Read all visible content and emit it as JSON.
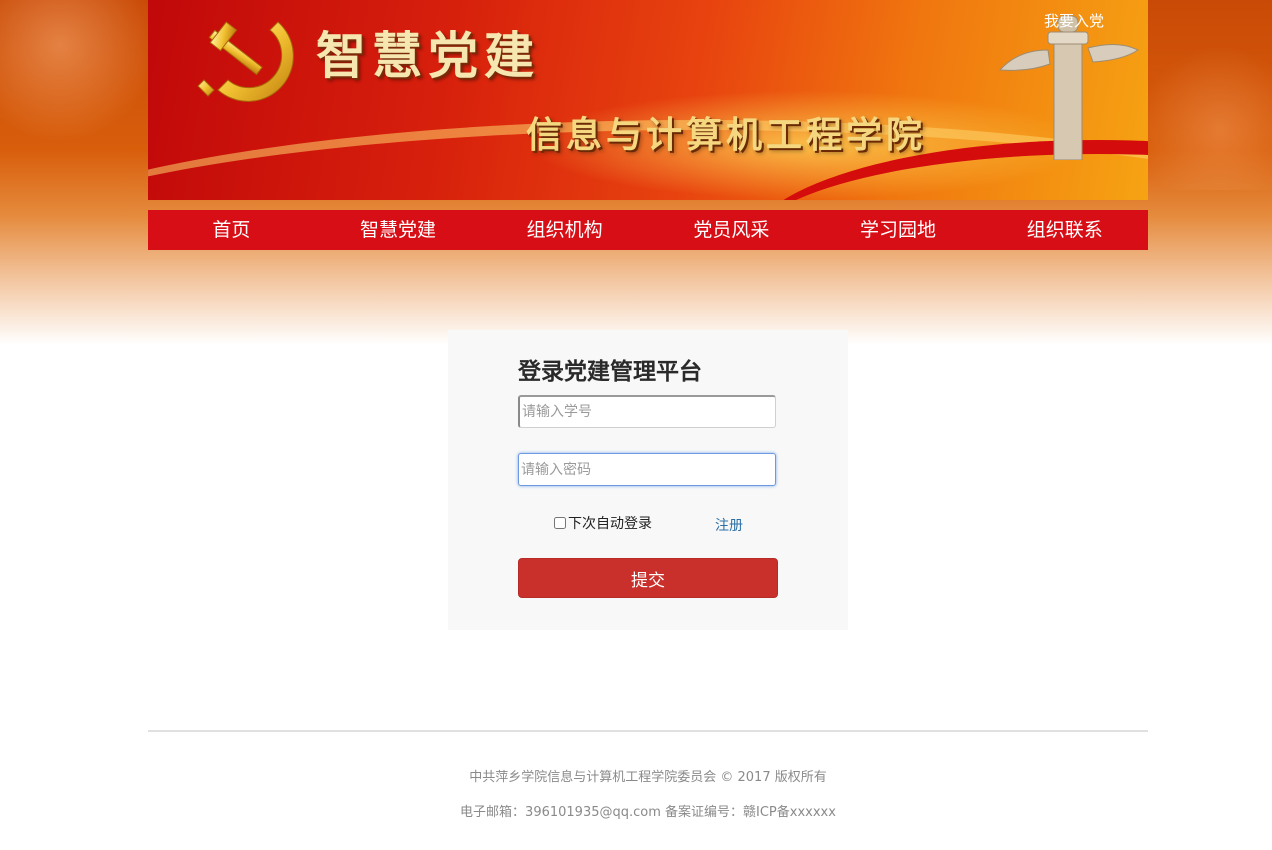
{
  "banner": {
    "title": "智慧党建",
    "subtitle": "信息与计算机工程学院",
    "join_link": "我要入党"
  },
  "nav": {
    "items": [
      "首页",
      "智慧党建",
      "组织机构",
      "党员风采",
      "学习园地",
      "组织联系"
    ]
  },
  "login": {
    "title": "登录党建管理平台",
    "student_id_placeholder": "请输入学号",
    "password_placeholder": "请输入密码",
    "remember_label": "下次自动登录",
    "register_label": "注册",
    "submit_label": "提交"
  },
  "footer": {
    "copyright": "中共萍乡学院信息与计算机工程学院委员会 © 2017 版权所有",
    "contact": "电子邮箱：396101935@qq.com 备案证编号：赣ICP备xxxxxx"
  },
  "colors": {
    "nav_bg": "#d80e16",
    "submit_bg": "#c9302c",
    "link": "#2a6fa8"
  },
  "icons": {
    "emblem": "hammer-sickle-icon",
    "pillar": "huabiao-pillar-icon"
  }
}
